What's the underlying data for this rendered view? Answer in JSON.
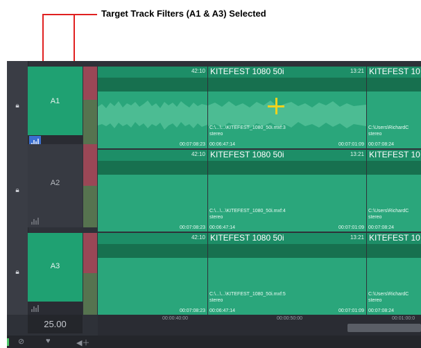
{
  "annotation": {
    "text": "Target Track Filters (A1 & A3) Selected"
  },
  "tracks": [
    {
      "name": "A1",
      "selected": true
    },
    {
      "name": "A2",
      "selected": false
    },
    {
      "name": "A3",
      "selected": true
    }
  ],
  "clips": {
    "track_suffixes": [
      "mxf:3",
      "mxf:4",
      "mxf:5"
    ],
    "left_clip_tc_end": "42:10",
    "title": "KITEFEST 1080 50i",
    "title_trunc": "KITEFEST 10",
    "right_clip_tc": "13:21",
    "path_prefix": "C:\\...\\...\\KITEFEST_1080_50i.",
    "path_right": "C:\\Users\\RichardC",
    "stereo": "stereo",
    "tc_start_left": "00:07:08:23",
    "tc_in": "00:06:47:14",
    "tc_out": "00:07:01:09",
    "tc_next": "00:07:08:24"
  },
  "ruler": {
    "ticks": [
      "00:00:40:00",
      "00:00:50:00",
      "00:01:00:0"
    ]
  },
  "timecode_box": "25.00",
  "colors": {
    "selected_track": "#1fa172",
    "clip": "#2aa67b",
    "arrow": "#e02020",
    "filter_on": "#3a6fd1"
  }
}
